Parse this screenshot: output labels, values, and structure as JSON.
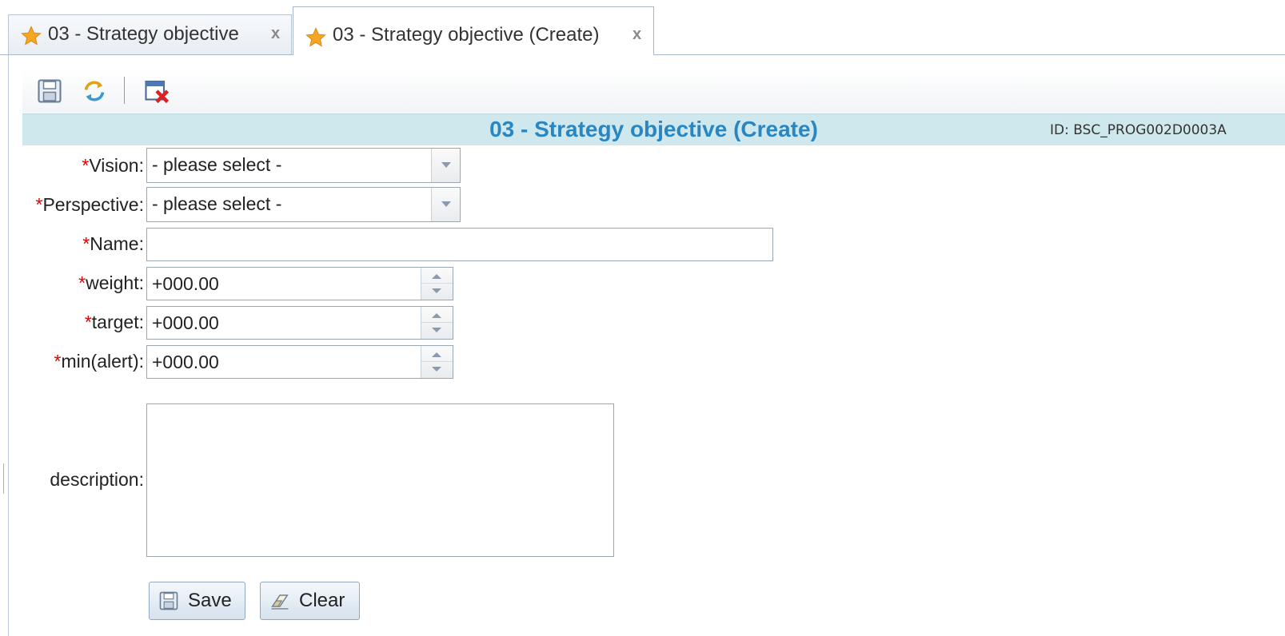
{
  "tabs": [
    {
      "label": "03 - Strategy objective",
      "icon": "star-icon",
      "close": "x",
      "active": false
    },
    {
      "label": "03 - Strategy objective (Create)",
      "icon": "star-icon",
      "close": "x",
      "active": true
    }
  ],
  "toolbar": {
    "buttons": [
      {
        "name": "save-icon"
      },
      {
        "name": "refresh-icon"
      },
      {
        "name": "close-page-icon"
      }
    ]
  },
  "header": {
    "title": "03 - Strategy objective (Create)",
    "program_id": "ID: BSC_PROG002D0003A"
  },
  "form": {
    "required_mark": "*",
    "vision": {
      "label": "Vision:",
      "value": "- please select -"
    },
    "perspective": {
      "label": "Perspective:",
      "value": "- please select -"
    },
    "name": {
      "label": "Name:",
      "value": ""
    },
    "weight": {
      "label": "weight:",
      "value": "+000.00"
    },
    "target": {
      "label": "target:",
      "value": "+000.00"
    },
    "min_alert": {
      "label": "min(alert):",
      "value": "+000.00"
    },
    "description": {
      "label": "description:",
      "value": ""
    }
  },
  "actions": {
    "save_label": "Save",
    "clear_label": "Clear"
  },
  "colors": {
    "title_bar_bg": "#cfe8ee",
    "title_text": "#2a86c0",
    "required_mark": "#e00000",
    "star": "#f5a623"
  }
}
